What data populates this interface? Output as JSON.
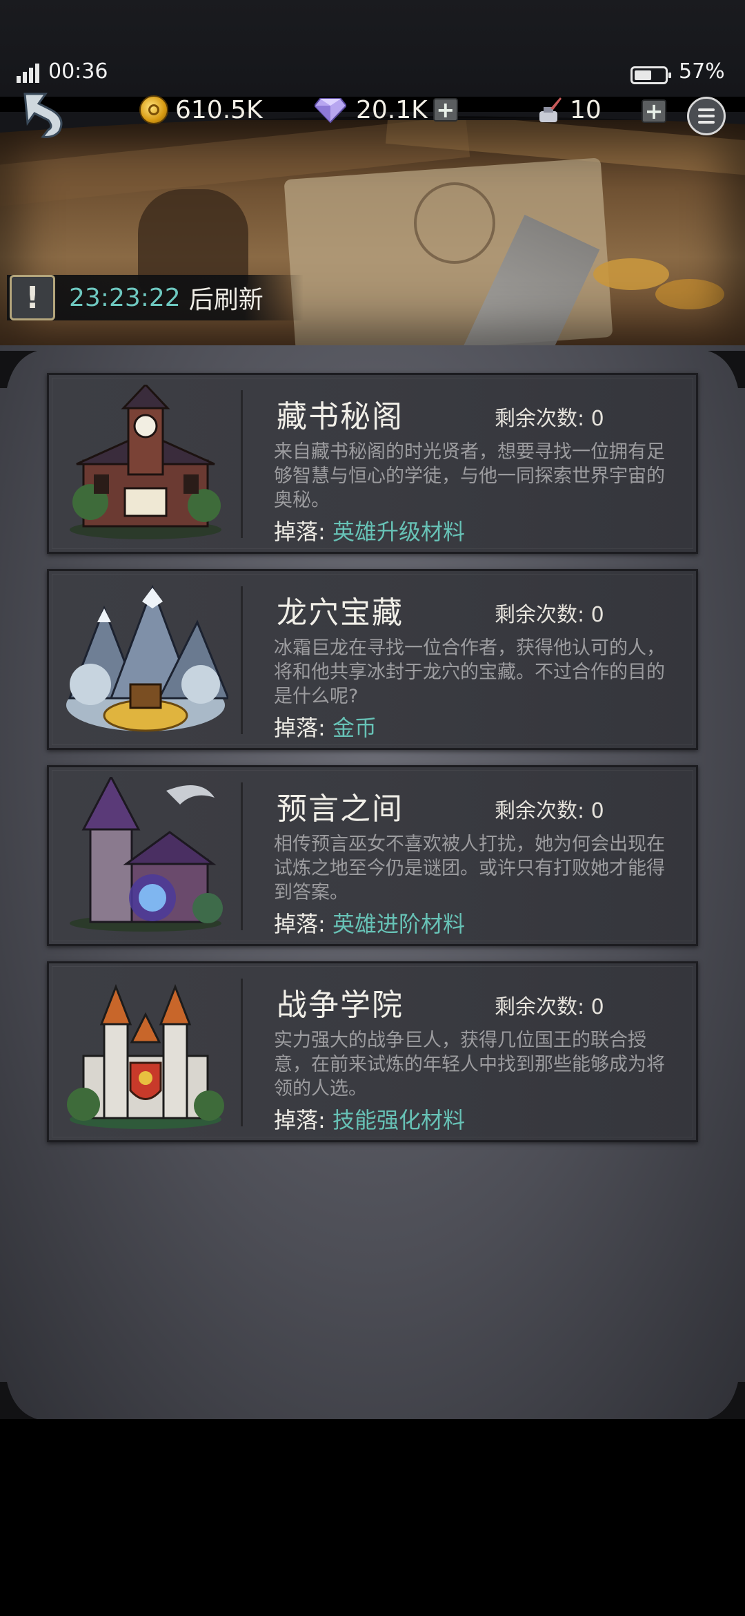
{
  "status_bar": {
    "time": "00:36",
    "battery_pct": "57%",
    "battery_level": 0.57
  },
  "resources": {
    "gold": "610.5K",
    "gems": "20.1K",
    "ink": "10",
    "plus": "+"
  },
  "banner": {
    "refresh_time": "23:23:22",
    "refresh_label": "后刷新",
    "alert_symbol": "!"
  },
  "cards": [
    {
      "title": "藏书秘阁",
      "remain_label": "剩余次数:",
      "remain_count": "0",
      "desc": "来自藏书秘阁的时光贤者，想要寻找一位拥有足够智慧与恒心的学徒，与他一同探索世界宇宙的奥秘。",
      "drop_label": "掉落:",
      "drop_value": "英雄升级材料",
      "icon": "library-tower-icon"
    },
    {
      "title": "龙穴宝藏",
      "remain_label": "剩余次数:",
      "remain_count": "0",
      "desc": "冰霜巨龙在寻找一位合作者，获得他认可的人，将和他共享冰封于龙穴的宝藏。不过合作的目的是什么呢?",
      "drop_label": "掉落:",
      "drop_value": "金币",
      "icon": "frozen-mountain-treasure-icon"
    },
    {
      "title": "预言之间",
      "remain_label": "剩余次数:",
      "remain_count": "0",
      "desc": "相传预言巫女不喜欢被人打扰，她为何会出现在试炼之地至今仍是谜团。或许只有打败她才能得到答案。",
      "drop_label": "掉落:",
      "drop_value": "英雄进阶材料",
      "icon": "witch-house-icon"
    },
    {
      "title": "战争学院",
      "remain_label": "剩余次数:",
      "remain_count": "0",
      "desc": "实力强大的战争巨人，获得几位国王的联合授意，在前来试炼的年轻人中找到那些能够成为将领的人选。",
      "drop_label": "掉落:",
      "drop_value": "技能强化材料",
      "icon": "war-castle-icon"
    }
  ],
  "colors": {
    "accent_teal": "#67c2b6",
    "panel": "#55565e",
    "card": "#3b3c42"
  }
}
